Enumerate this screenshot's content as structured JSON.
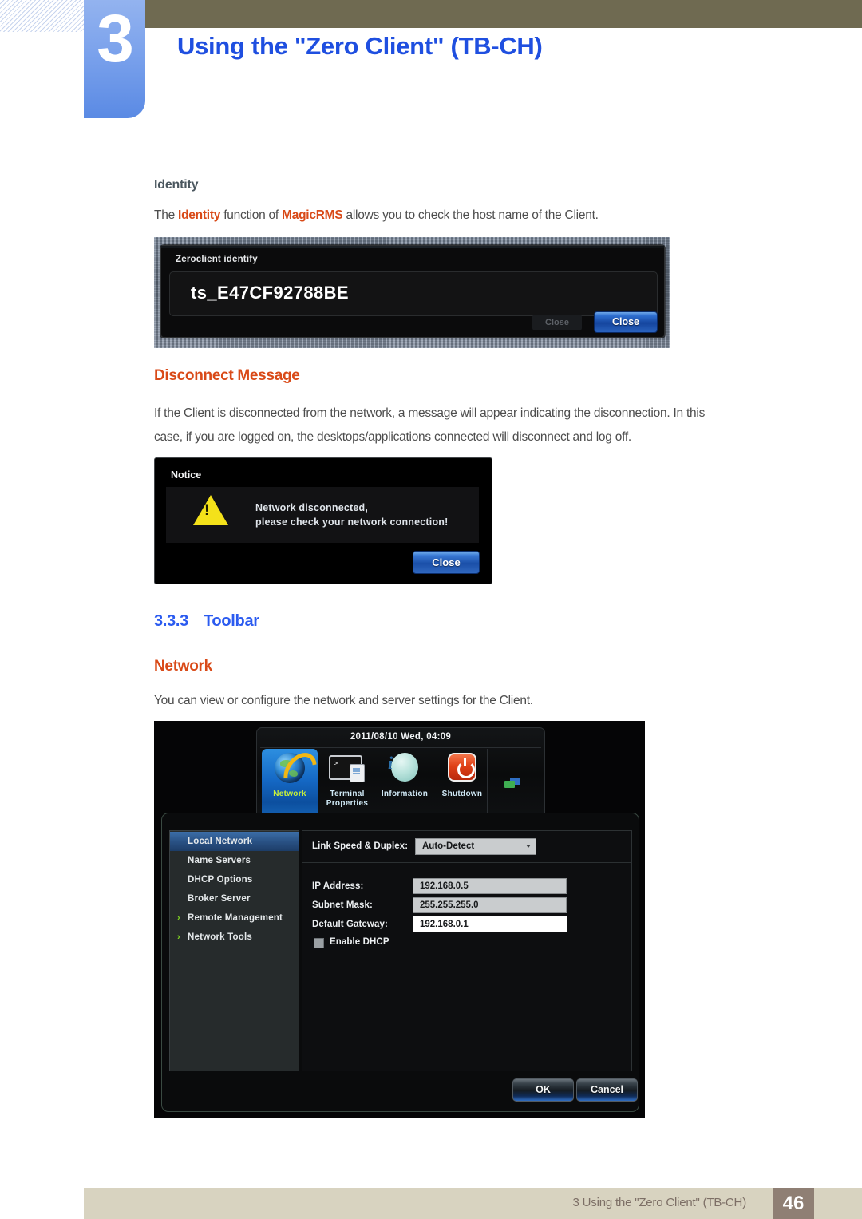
{
  "header": {
    "chapter_number": "3",
    "chapter_title": "Using the \"Zero Client\" (TB-CH)"
  },
  "identity_section": {
    "heading": "Identity",
    "body_pre": "The ",
    "body_hl1": "Identity",
    "body_mid": " function of ",
    "body_hl2": "MagicRMS",
    "body_post": " allows you to check the host name of the Client.",
    "screenshot": {
      "dialog_title": "Zeroclient identify",
      "host_name": "ts_E47CF92788BE",
      "close_ghost_label": "Close",
      "close_button_label": "Close"
    }
  },
  "disconnect_section": {
    "heading": "Disconnect Message",
    "body_line1": "If the Client is disconnected from the network, a message will appear indicating the disconnection. In this",
    "body_line2": "case, if you are logged on, the desktops/applications connected will disconnect and log off.",
    "screenshot": {
      "dialog_title": "Notice",
      "message_line1": "Network disconnected,",
      "message_line2": "please check your network connection!",
      "warning_glyph": "!",
      "close_button_label": "Close"
    }
  },
  "toolbar_section": {
    "number": "3.3.3",
    "heading": "Toolbar",
    "subheading": "Network",
    "body": "You can view or configure the network and server settings for the Client.",
    "screenshot": {
      "datetime": "2011/08/10 Wed, 04:09",
      "toolbar_items": [
        {
          "label": "Network",
          "icon": "globe-icon",
          "selected": true
        },
        {
          "label_line1": "Terminal",
          "label_line2": "Properties",
          "icon": "terminal-icon",
          "selected": false
        },
        {
          "label": "Information",
          "icon": "info-icon",
          "selected": false
        },
        {
          "label": "Shutdown",
          "icon": "power-icon",
          "selected": false
        }
      ],
      "tray_icon": "network-tray-icon",
      "sidebar_items": [
        {
          "label": "Local Network",
          "selected": true,
          "expandable": false
        },
        {
          "label": "Name Servers",
          "selected": false,
          "expandable": false
        },
        {
          "label": "DHCP Options",
          "selected": false,
          "expandable": false
        },
        {
          "label": "Broker Server",
          "selected": false,
          "expandable": false
        },
        {
          "label": "Remote Management",
          "selected": false,
          "expandable": true
        },
        {
          "label": "Network Tools",
          "selected": false,
          "expandable": true
        }
      ],
      "chevron_glyph": "›",
      "form": {
        "link_speed_label": "Link Speed & Duplex:",
        "link_speed_value": "Auto-Detect",
        "ip_label": "IP Address:",
        "ip_value": "192.168.0.5",
        "subnet_label": "Subnet Mask:",
        "subnet_value": "255.255.255.0",
        "gateway_label": "Default Gateway:",
        "gateway_value": "192.168.0.1",
        "dhcp_label": "Enable DHCP"
      },
      "ok_label": "OK",
      "cancel_label": "Cancel"
    }
  },
  "footer": {
    "text": "3 Using the \"Zero Client\" (TB-CH)",
    "page": "46"
  }
}
